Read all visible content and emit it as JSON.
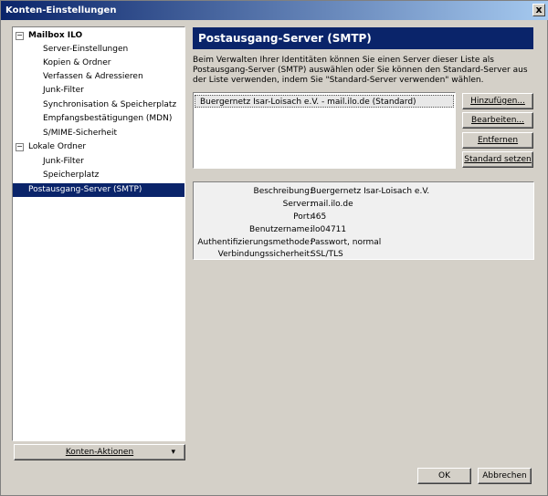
{
  "window": {
    "title": "Konten-Einstellungen",
    "close_glyph": "x"
  },
  "tree": {
    "items": [
      {
        "label": "Mailbox ILO",
        "level": 0,
        "expanded": true,
        "bold": true
      },
      {
        "label": "Server-Einstellungen",
        "level": 1
      },
      {
        "label": "Kopien & Ordner",
        "level": 1
      },
      {
        "label": "Verfassen & Adressieren",
        "level": 1
      },
      {
        "label": "Junk-Filter",
        "level": 1
      },
      {
        "label": "Synchronisation & Speicherplatz",
        "level": 1
      },
      {
        "label": "Empfangsbestätigungen (MDN)",
        "level": 1
      },
      {
        "label": "S/MIME-Sicherheit",
        "level": 1
      },
      {
        "label": "Lokale Ordner",
        "level": 0,
        "expanded": true
      },
      {
        "label": "Junk-Filter",
        "level": 1
      },
      {
        "label": "Speicherplatz",
        "level": 1
      },
      {
        "label": "Postausgang-Server (SMTP)",
        "level": 0,
        "selected": true
      }
    ]
  },
  "account_actions": {
    "label": "Konten-Aktionen",
    "arrow": "▾"
  },
  "panel": {
    "title": "Postausgang-Server (SMTP)",
    "description": "Beim Verwalten Ihrer Identitäten können Sie einen Server dieser Liste als Postausgang-Server (SMTP) auswählen oder Sie können den Standard-Server aus der Liste verwenden, indem Sie \"Standard-Server verwenden\" wählen.",
    "servers": [
      "Buergernetz Isar-Loisach e.V. - mail.ilo.de (Standard)"
    ],
    "buttons": {
      "add": "Hinzufügen...",
      "edit": "Bearbeiten...",
      "remove": "Entfernen",
      "set_default": "Standard setzen"
    },
    "details": [
      {
        "label": "Beschreibung:",
        "value": "Buergernetz Isar-Loisach e.V."
      },
      {
        "label": "Server:",
        "value": "mail.ilo.de"
      },
      {
        "label": "Port:",
        "value": "465"
      },
      {
        "label": "Benutzername:",
        "value": "ilo04711"
      },
      {
        "label": "Authentifizierungsmethode:",
        "value": "Passwort, normal"
      },
      {
        "label": "Verbindungssicherheit:",
        "value": "SSL/TLS"
      }
    ]
  },
  "footer": {
    "ok": "OK",
    "cancel": "Abbrechen"
  }
}
